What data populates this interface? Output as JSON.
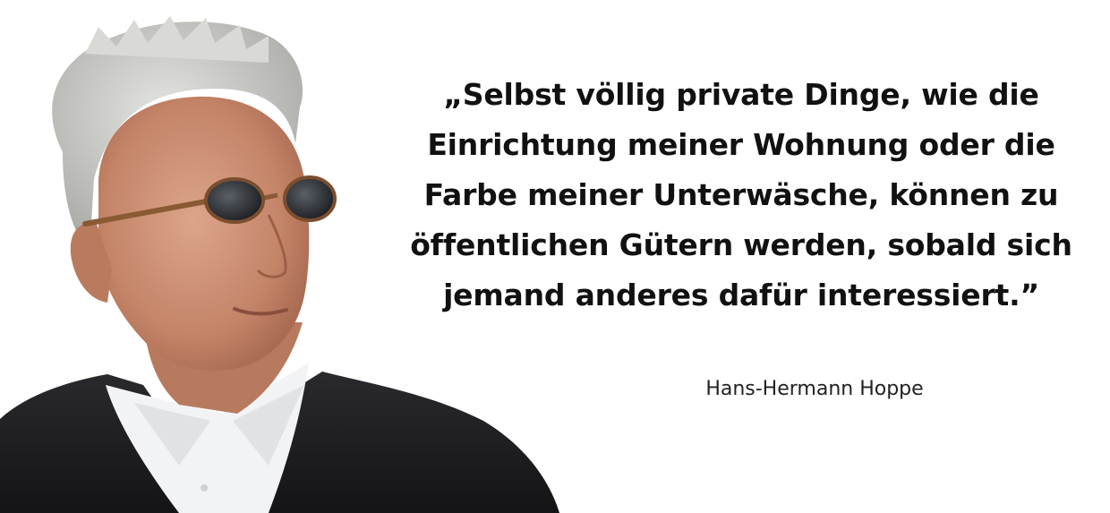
{
  "quote": {
    "lines": [
      "„Selbst völlig private Dinge, wie die",
      "Einrichtung meiner Wohnung oder die",
      "Farbe meiner Unterwäsche, können zu",
      "öffentlichen Gütern werden, sobald sich",
      "jemand anderes dafür interessiert.”"
    ]
  },
  "author": "Hans-Hermann Hoppe",
  "colors": {
    "background": "#ffffff",
    "text": "#111111",
    "jacket": "#1b1b1e",
    "shirt": "#f2f3f5",
    "skin": "#c98f73",
    "hair": "#c9c9c6"
  }
}
